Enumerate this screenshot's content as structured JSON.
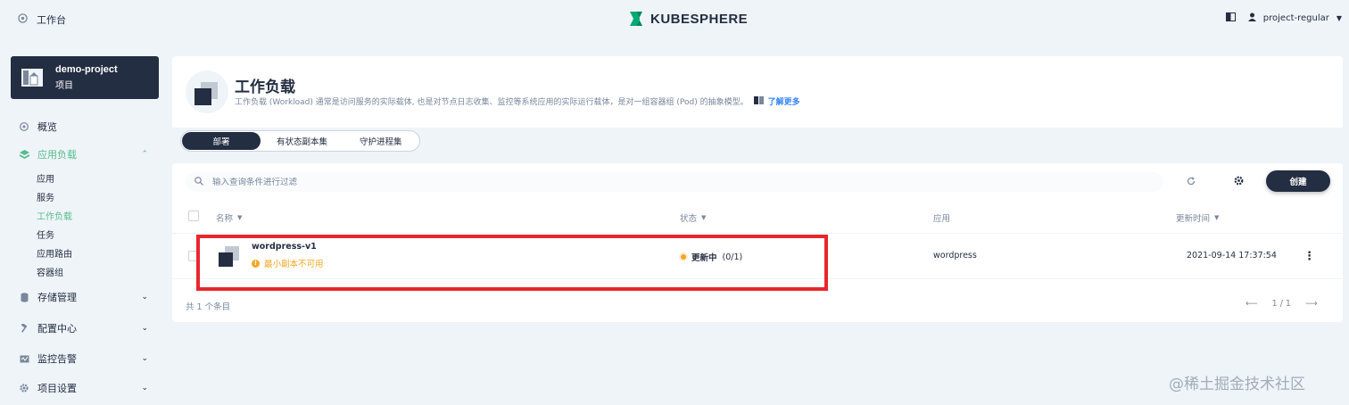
{
  "topbar": {
    "workbench_label": "工作台",
    "brand": "KUBESPHERE",
    "user": "project-regular",
    "brand_color": "#00aa72"
  },
  "sidebar": {
    "project": {
      "name": "demo-project",
      "type": "项目"
    },
    "items": [
      {
        "label": "概览",
        "icon": "dashboard-icon"
      },
      {
        "label": "应用负载",
        "icon": "appstore-icon",
        "active": true
      },
      {
        "label": "存储管理",
        "icon": "storage-icon"
      },
      {
        "label": "配置中心",
        "icon": "hammer-icon"
      },
      {
        "label": "监控告警",
        "icon": "monitor-icon"
      },
      {
        "label": "项目设置",
        "icon": "gear-icon"
      }
    ],
    "subitems": [
      "应用",
      "服务",
      "工作负载",
      "任务",
      "应用路由",
      "容器组"
    ],
    "active_subitem": "工作负载"
  },
  "header": {
    "title": "工作负载",
    "description": "工作负载 (Workload) 通常是访问服务的实际载体, 也是对节点日志收集、监控等系统应用的实际运行载体，是对一组容器组 (Pod) 的抽象模型。",
    "learn_more": "了解更多"
  },
  "tabs": [
    "部署",
    "有状态副本集",
    "守护进程集"
  ],
  "toolbar": {
    "search_placeholder": "输入查询条件进行过滤",
    "create_label": "创建"
  },
  "table": {
    "columns": [
      "名称",
      "状态",
      "应用",
      "更新时间"
    ],
    "rows": [
      {
        "name": "wordpress-v1",
        "warning": "最小副本不可用",
        "status": "更新中",
        "status_count": "(0/1)",
        "app": "wordpress",
        "updated": "2021-09-14 17:37:54"
      }
    ],
    "total": "共 1 个条目",
    "page": "1 / 1"
  },
  "colors": {
    "accent": "#55bc8a",
    "dark": "#242e42",
    "warning": "#f5a623",
    "highlight": "#e8262d"
  },
  "watermark": "@稀土掘金技术社区"
}
